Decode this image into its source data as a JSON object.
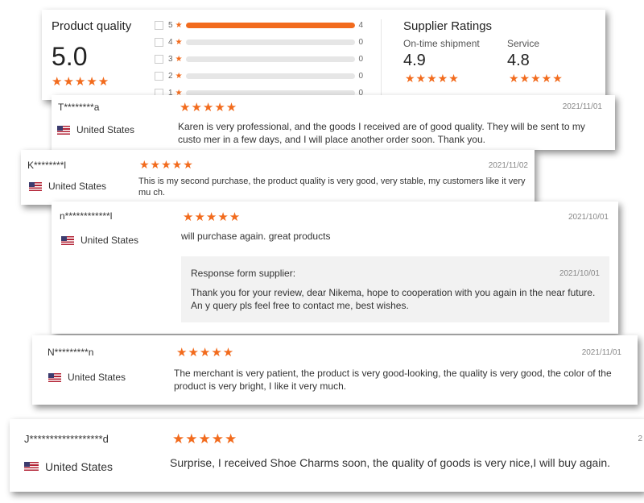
{
  "summary": {
    "title": "Product quality",
    "score": "5.0",
    "stars": "★★★★★",
    "distribution": [
      {
        "label": "5",
        "count": "4",
        "fraction": 1.0
      },
      {
        "label": "4",
        "count": "0",
        "fraction": 0
      },
      {
        "label": "3",
        "count": "0",
        "fraction": 0
      },
      {
        "label": "2",
        "count": "0",
        "fraction": 0
      },
      {
        "label": "1",
        "count": "0",
        "fraction": 0
      }
    ],
    "supplier_title": "Supplier Ratings",
    "on_time_label": "On-time shipment",
    "on_time_value": "4.9",
    "service_label": "Service",
    "service_value": "4.8",
    "star_glyph": "★",
    "accent": "#f26b1d"
  },
  "reviews": [
    {
      "name": "T********a",
      "country": "United States",
      "date": "2021/11/01",
      "stars": "★★★★★",
      "text": "Karen is very professional, and the goods I received are of good quality. They will be sent to my custo mer in a few days, and I will place another order soon. Thank you."
    },
    {
      "name": "K********l",
      "country": "United States",
      "date": "2021/11/02",
      "stars": "★★★★★",
      "text": "This is my second purchase, the product quality is very good, very stable, my customers like it very mu ch."
    },
    {
      "name": "n************l",
      "country": "United States",
      "date": "2021/10/01",
      "stars": "★★★★★",
      "text": "will purchase again. great products",
      "response": {
        "label": "Response form supplier:",
        "date": "2021/10/01",
        "text": "Thank you for your review, dear Nikema, hope to cooperation with you again in the near future. An y query pls feel free to contact me, best wishes."
      }
    },
    {
      "name": "N*********n",
      "country": "United States",
      "date": "2021/11/01",
      "stars": "★★★★★",
      "text": "The merchant is very patient, the product is very good-looking, the quality is very good, the color of the product is very bright, I like it very much."
    },
    {
      "name": "J******************d",
      "country": "United States",
      "date": "2",
      "stars": "★★★★★",
      "text": "Surprise, I received Shoe Charms soon, the quality of goods is very nice,I will buy again."
    }
  ]
}
